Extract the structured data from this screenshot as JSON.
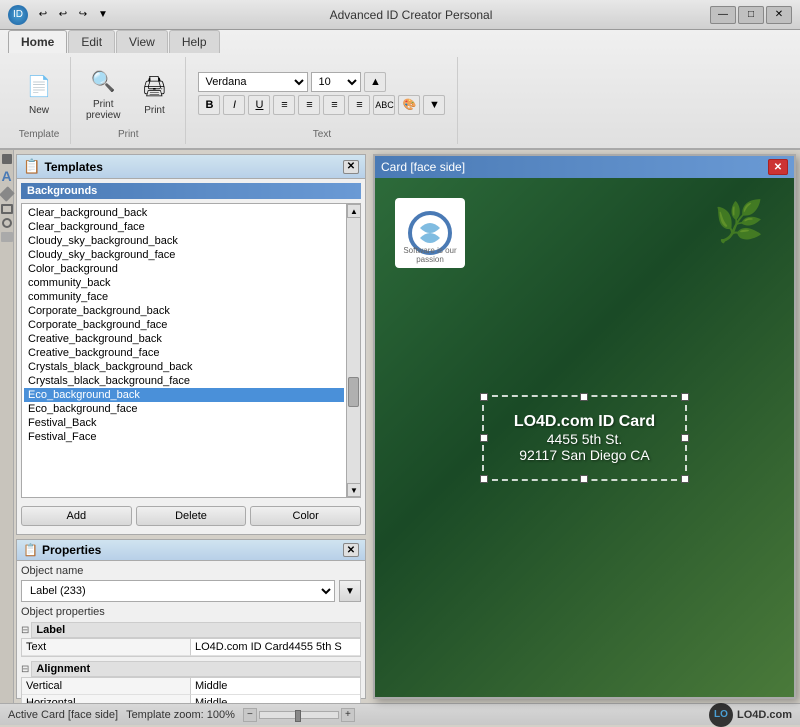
{
  "app": {
    "title": "Advanced ID Creator Personal",
    "titlebar_controls": [
      "—",
      "□",
      "✕"
    ]
  },
  "qat": {
    "buttons": [
      "↩",
      "↩",
      "↪",
      "▼"
    ]
  },
  "ribbon": {
    "tabs": [
      "Home",
      "Edit",
      "View",
      "Help"
    ],
    "active_tab": "Home",
    "groups": {
      "template": {
        "label": "Template",
        "new_label": "New",
        "print_preview_label": "Print\npreview",
        "print_label": "Print"
      },
      "print": {
        "label": "Print"
      },
      "text": {
        "label": "Text",
        "font": "Verdana",
        "size": "10",
        "format_buttons": [
          "B",
          "I",
          "U",
          "≡",
          "≡",
          "≡",
          "≡",
          "ABC",
          "🎨",
          "▼"
        ]
      }
    }
  },
  "templates_panel": {
    "title": "Templates",
    "category": "Backgrounds",
    "items": [
      "Clear_background_back",
      "Clear_background_face",
      "Cloudy_sky_background_back",
      "Cloudy_sky_background_face",
      "Color_background",
      "community_back",
      "community_face",
      "Corporate_background_back",
      "Corporate_background_face",
      "Creative_background_back",
      "Creative_background_face",
      "Crystals_black_background_back",
      "Crystals_black_background_face",
      "Eco_background_back",
      "Eco_background_face",
      "Festival_Back",
      "Festival_Face"
    ],
    "selected_item": "Eco_background_back",
    "buttons": [
      "Add",
      "Delete",
      "Color"
    ]
  },
  "properties_panel": {
    "title": "Properties",
    "object_name_label": "Object name",
    "object_name_value": "Label (233)",
    "object_properties_label": "Object properties",
    "sections": {
      "label": {
        "title": "Label",
        "rows": [
          {
            "key": "Text",
            "value": "LO4D.com ID Card4455 5th S"
          }
        ]
      },
      "alignment": {
        "title": "Alignment",
        "rows": [
          {
            "key": "Vertical",
            "value": "Middle"
          },
          {
            "key": "Horizontal",
            "value": "Middle"
          }
        ]
      }
    }
  },
  "card": {
    "title": "Card [face side]",
    "company_name": "LO4D.com ID Card",
    "address1": "4455 5th St.",
    "address2": "92117 San Diego CA"
  },
  "statusbar": {
    "active_card": "Active Card [face side]",
    "zoom_label": "Template zoom: 100%",
    "logo_text": "LO4D.com"
  }
}
